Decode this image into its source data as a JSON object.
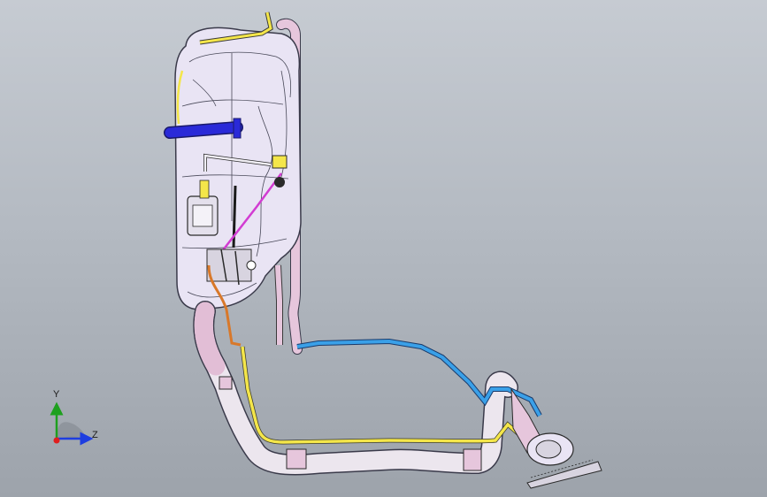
{
  "viewport": {
    "background_top": "#c6cbd2",
    "background_bottom": "#9da3ab"
  },
  "model": {
    "description_icon": "fuel-tank-assembly-model",
    "colors": {
      "tank_body": "#e9e4f4",
      "tank_edge": "#3a3a4a",
      "strap": "#2a2ad8",
      "yellow_line": "#f4e64a",
      "blue_line": "#3aa0e8",
      "pink_pipe": "#e6c6dc",
      "filler_pipe": "#ece6ee",
      "orange_line": "#d8782a",
      "magenta_line": "#d23cd2"
    }
  },
  "triad": {
    "y_label": "Y",
    "z_label": "Z",
    "y_color": "#1ea01e",
    "z_color": "#1e3ee0",
    "x_color": "#e01e1e"
  }
}
